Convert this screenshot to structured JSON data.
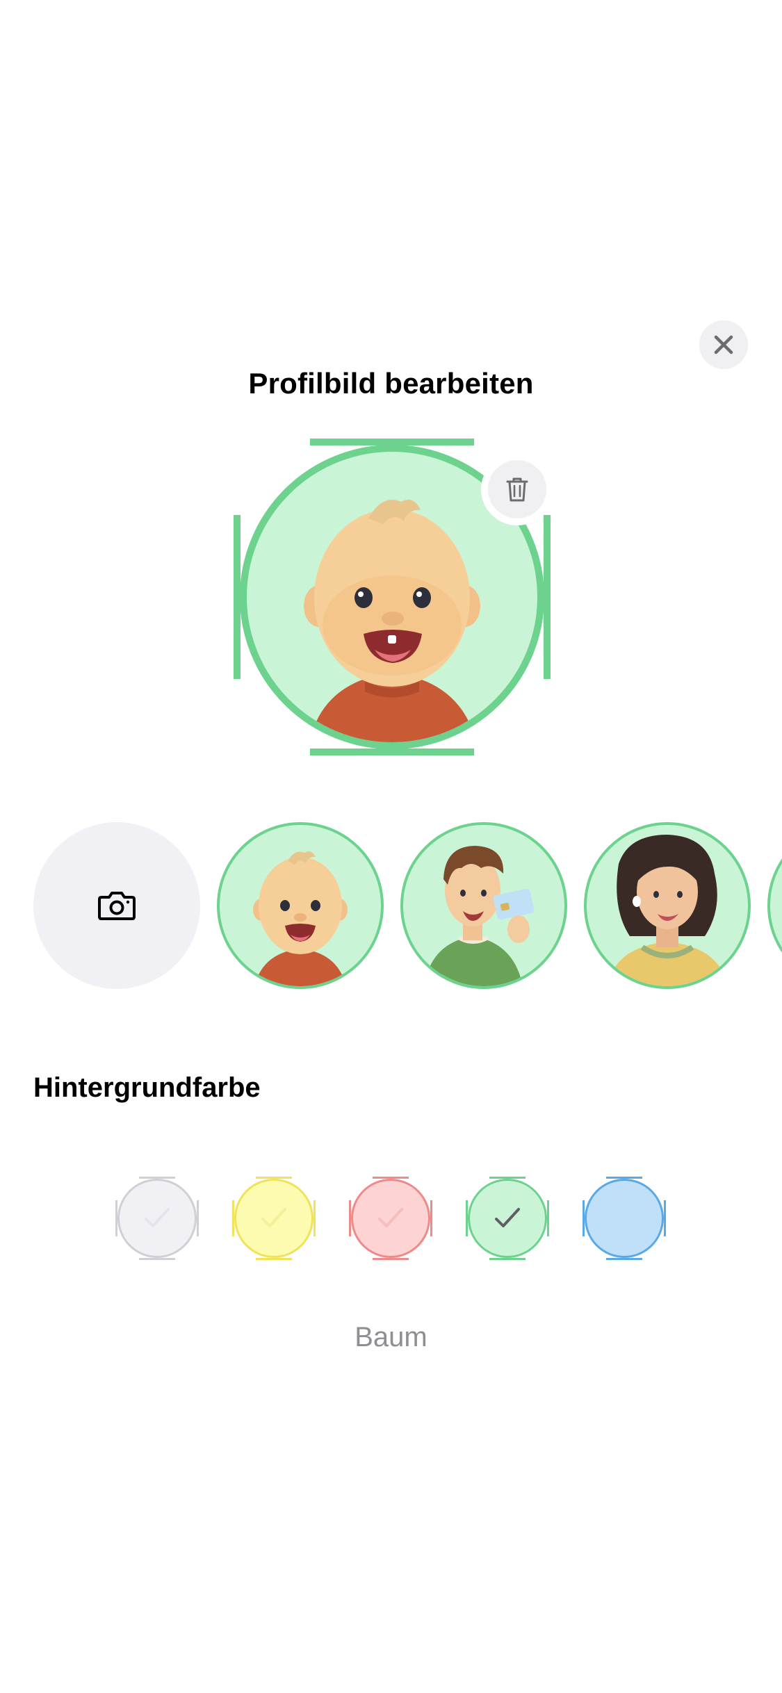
{
  "dialog": {
    "title": "Profilbild bearbeiten",
    "close_icon": "close-icon",
    "delete_icon": "trash-icon"
  },
  "avatar_picker": {
    "camera_icon": "camera-icon",
    "options": [
      {
        "name": "baby-avatar",
        "selected": true
      },
      {
        "name": "young-man-with-id-card-avatar",
        "selected": false
      },
      {
        "name": "woman-with-earbuds-avatar",
        "selected": false
      },
      {
        "name": "partially-visible-avatar",
        "selected": false
      }
    ]
  },
  "background": {
    "section_title": "Hintergrundfarbe",
    "selected_label": "Baum",
    "colors": [
      {
        "fill": "#f1f1f5",
        "stroke": "#cfcfd6",
        "selected": false
      },
      {
        "fill": "#fdfbb0",
        "stroke": "#f0e35a",
        "selected": false
      },
      {
        "fill": "#fdd3d3",
        "stroke": "#ef8a8a",
        "selected": false
      },
      {
        "fill": "#c9f5d6",
        "stroke": "#6cd28e",
        "selected": true
      },
      {
        "fill": "#bfe0f8",
        "stroke": "#5aa8e6",
        "selected": false
      }
    ]
  },
  "colors": {
    "accent_green": "#6cd28e",
    "avatar_bg": "#c9f5d6",
    "secondary_text": "#8e8e93",
    "button_bg": "#f0f0f3"
  }
}
